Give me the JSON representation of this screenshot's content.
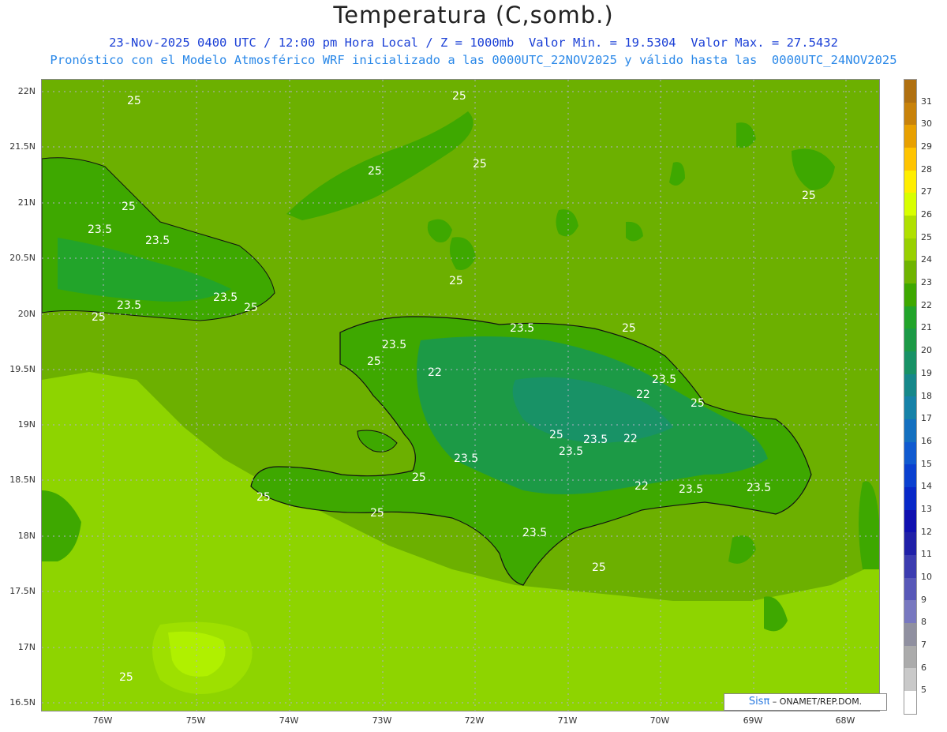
{
  "header": {
    "title": "Temperatura (C,somb.)",
    "line1": "23-Nov-2025 0400 UTC / 12:00 pm Hora Local / Z = 1000mb  Valor Min. = 19.5304  Valor Max. = 27.5432",
    "line2": "Pronóstico con el Modelo Atmosférico WRF inicializado a las 0000UTC_22NOV2025 y válido hasta las  0000UTC_24NOV2025"
  },
  "axes": {
    "lat_labels": [
      "22N",
      "21.5N",
      "21N",
      "20.5N",
      "20N",
      "19.5N",
      "19N",
      "18.5N",
      "18N",
      "17.5N",
      "17N",
      "16.5N"
    ],
    "lon_labels": [
      "76W",
      "75W",
      "74W",
      "73W",
      "72W",
      "71W",
      "70W",
      "69W",
      "68W"
    ]
  },
  "colorbar": {
    "labels": [
      "31",
      "30",
      "29",
      "28",
      "27",
      "26",
      "25",
      "24",
      "23",
      "22",
      "21",
      "20",
      "19",
      "18",
      "17",
      "16",
      "15",
      "14",
      "13",
      "12",
      "11",
      "10",
      "9",
      "8",
      "7",
      "6",
      "5"
    ],
    "colors": [
      "#c8820a",
      "#e8a000",
      "#ffc400",
      "#ffee00",
      "#d8ff00",
      "#b0e000",
      "#98d000",
      "#6fb400",
      "#3ea800",
      "#22a42a",
      "#1c9a46",
      "#189266",
      "#16888a",
      "#1682a8",
      "#1470c0",
      "#105ad0",
      "#0a40d0",
      "#0828c8",
      "#1010b0",
      "#2020a8",
      "#3c3cb0",
      "#5858b8",
      "#7878c0",
      "#9090a0",
      "#ababab",
      "#c9c9c9",
      "#ffffff"
    ]
  },
  "contour_labels": [
    "25",
    "25",
    "25",
    "25",
    "25",
    "23.5",
    "23.5",
    "23.5",
    "23.5",
    "25",
    "25",
    "25",
    "25",
    "23.5",
    "23.5",
    "22",
    "23.5",
    "22",
    "23.5",
    "25",
    "25",
    "23.5",
    "23.5",
    "22",
    "25",
    "25",
    "22",
    "23.5",
    "23.5",
    "25",
    "23.5",
    "25",
    "25",
    "25",
    "25"
  ],
  "credit": {
    "logo": "Sisπ",
    "text": "– ONAMET/REP.DOM."
  }
}
